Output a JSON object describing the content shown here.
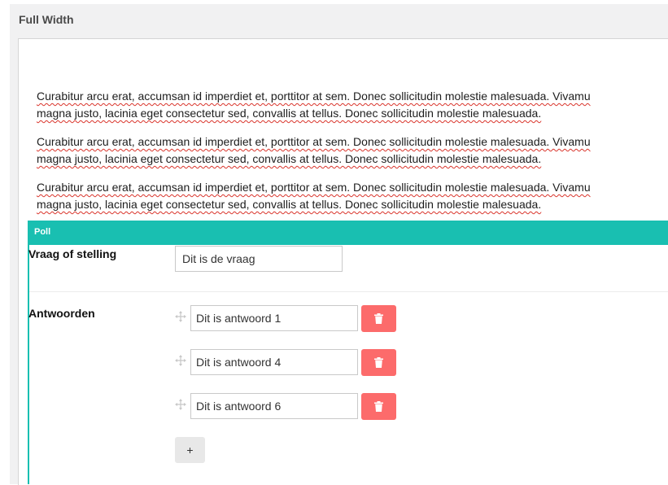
{
  "panel": {
    "title": "Full Width"
  },
  "editor": {
    "paragraphs": [
      {
        "line1": "Curabitur arcu erat, accumsan id imperdiet et, porttitor at sem. Donec sollicitudin molestie malesuada. Vivamu",
        "line2": "magna justo, lacinia eget consectetur sed, convallis at tellus. Donec sollicitudin molestie malesuada."
      },
      {
        "line1": "Curabitur arcu erat, accumsan id imperdiet et, porttitor at sem. Donec sollicitudin molestie malesuada. Vivamu",
        "line2": "magna justo, lacinia eget consectetur sed, convallis at tellus. Donec sollicitudin molestie malesuada."
      },
      {
        "line1": "Curabitur arcu erat, accumsan id imperdiet et, porttitor at sem. Donec sollicitudin molestie malesuada. Vivamu",
        "line2": "magna justo, lacinia eget consectetur sed, convallis at tellus. Donec sollicitudin molestie malesuada."
      }
    ]
  },
  "poll": {
    "header": "Poll",
    "accent_color": "#19bfb1",
    "question_label": "Vraag of stelling",
    "question_value": "Dit is de vraag",
    "answers_label": "Antwoorden",
    "answers": [
      {
        "value": "Dit is antwoord 1"
      },
      {
        "value": "Dit is antwoord 4"
      },
      {
        "value": "Dit is antwoord 6"
      }
    ],
    "delete_icon": "trash-icon",
    "delete_color": "#fc6b6b",
    "drag_icon": "move-icon",
    "add_label": "+"
  }
}
